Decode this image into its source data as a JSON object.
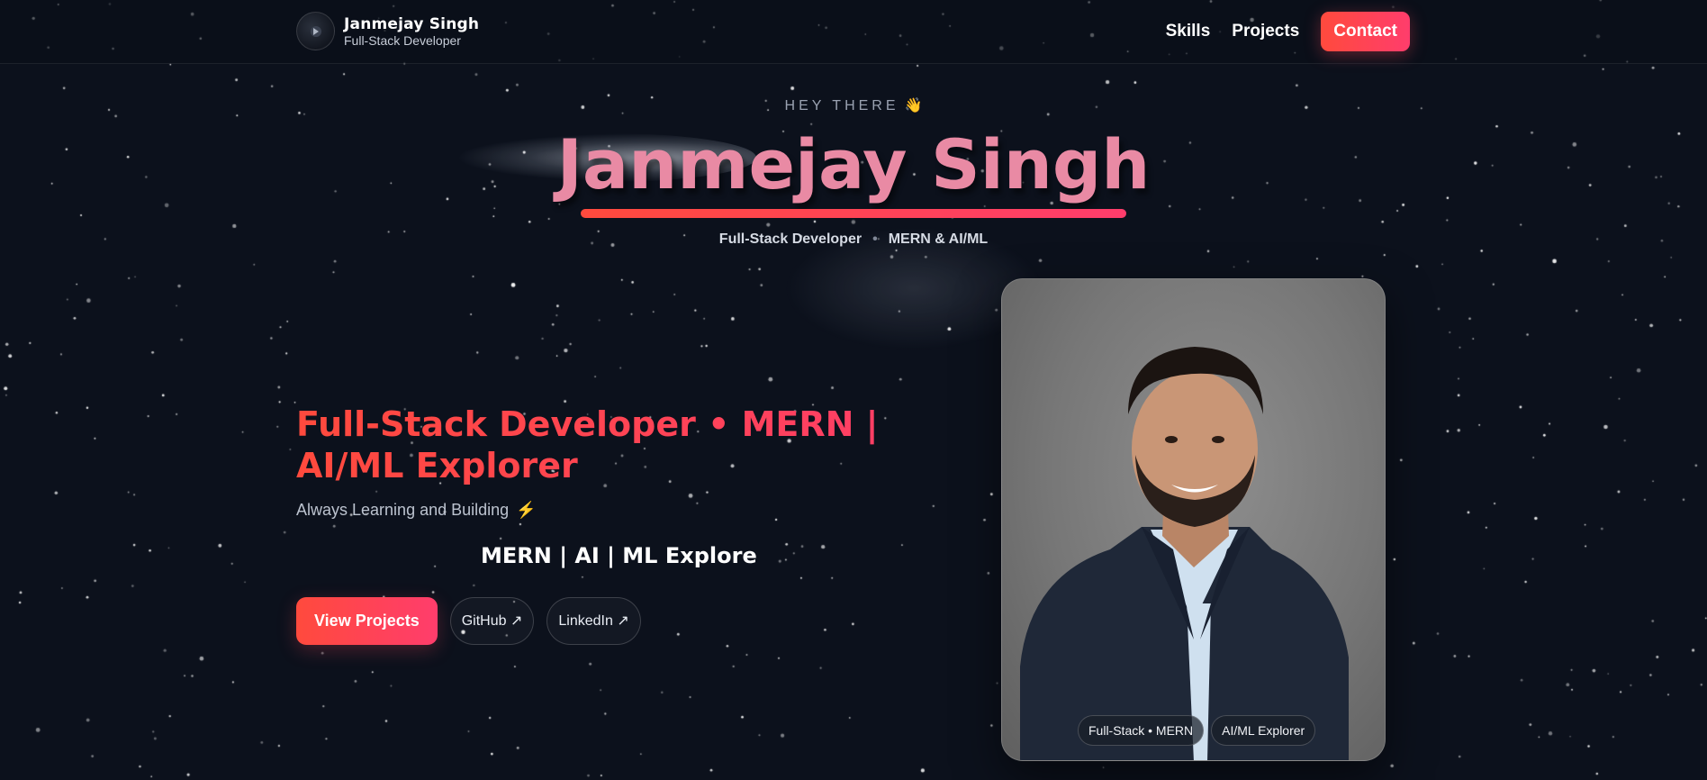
{
  "nav": {
    "brand_name": "Janmejay Singh",
    "brand_role": "Full-Stack Developer",
    "links": [
      "Skills",
      "Projects"
    ],
    "contact_label": "Contact"
  },
  "hero": {
    "greeting": "HEY THERE",
    "greeting_emoji": "👋",
    "name": "Janmejay Singh",
    "tagline_left": "Full-Stack Developer",
    "tagline_sep": "•",
    "tagline_right": "MERN & AI/ML",
    "headline": "Full-Stack Developer • MERN | AI/ML Explorer",
    "subline": "Always Learning and Building",
    "subline_emoji": "⚡",
    "typed_text": "MERN | AI | ML Explore",
    "buttons": {
      "primary": "View Projects",
      "github": "GitHub ↗",
      "linkedin": "LinkedIn ↗"
    }
  },
  "photo": {
    "chips": [
      "Full-Stack • MERN",
      "AI/ML Explorer"
    ]
  },
  "icons": {
    "logo": "logo-icon",
    "wave": "wave-icon",
    "bolt": "lightning-icon"
  },
  "colors": {
    "background": "#0c111c",
    "accent_start": "#ff4a3d",
    "accent_end": "#ff3d6c",
    "name_pink": "#e98aa4"
  }
}
